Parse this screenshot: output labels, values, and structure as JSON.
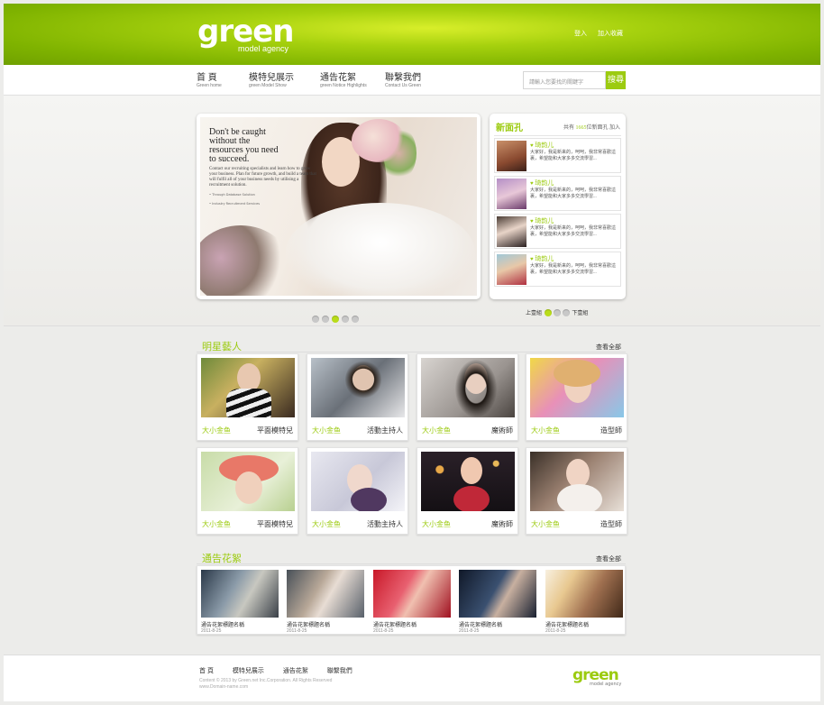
{
  "brand": {
    "logo_word": "green",
    "tagline": "model agency"
  },
  "top_links": [
    "登入",
    "加入收藏"
  ],
  "nav": [
    {
      "label": "首 頁",
      "sub": "Green home"
    },
    {
      "label": "模特兒展示",
      "sub": "green Model  Show"
    },
    {
      "label": "通告花絮",
      "sub": "green Notice Highlights"
    },
    {
      "label": "聯繫我們",
      "sub": "Contact Us Green"
    }
  ],
  "search": {
    "placeholder": "請輸入您要找的關鍵字",
    "button": "搜尋"
  },
  "slider": {
    "headline": [
      "Don't be caught",
      "without the",
      "resources you need",
      "to succeed."
    ],
    "body": "Contact our recruiting specialists and learn how to grow your business. Plan for future growth, and build a team that will fulfil all of your business needs by utilising a recruitment solution.",
    "footnotes": [
      "• Through Database Solution",
      "• Industry Recruitment Services"
    ],
    "dots": 5,
    "active_dot": 3
  },
  "new_faces": {
    "title": "新面孔",
    "count_prefix": "共有",
    "count": "1665",
    "count_suffix": "位新面孔  加入",
    "items": [
      {
        "name": "琦韵儿",
        "desc": "大家好，我是新来的，呵呵，我非常喜歡這裏，希望能和大家多多交流學習..."
      },
      {
        "name": "琦韵儿",
        "desc": "大家好，我是新来的，呵呵，我非常喜歡這裏，希望能和大家多多交流學習..."
      },
      {
        "name": "琦韵儿",
        "desc": "大家好，我是新来的，呵呵，我非常喜歡這裏，希望能和大家多多交流學習..."
      },
      {
        "name": "琦韵儿",
        "desc": "大家好，我是新来的，呵呵，我非常喜歡這裏，希望能和大家多多交流學習..."
      }
    ],
    "prev": "上壹組",
    "next": "下壹組",
    "pager_dots": 3,
    "active_pager": 1
  },
  "stars": {
    "title": "明星藝人",
    "view_all": "查看全部",
    "cards": [
      {
        "name": "大小金鱼",
        "role": "平面模特兒"
      },
      {
        "name": "大小金鱼",
        "role": "活動主持人"
      },
      {
        "name": "大小金鱼",
        "role": "魔術師"
      },
      {
        "name": "大小金鱼",
        "role": "造型師"
      },
      {
        "name": "大小金鱼",
        "role": "平面模特兒"
      },
      {
        "name": "大小金鱼",
        "role": "活動主持人"
      },
      {
        "name": "大小金鱼",
        "role": "魔術師"
      },
      {
        "name": "大小金鱼",
        "role": "造型師"
      }
    ]
  },
  "notices": {
    "title": "通告花絮",
    "view_all": "查看全部",
    "items": [
      {
        "title": "通告花絮標題名稱",
        "date": "2011-8-25"
      },
      {
        "title": "通告花絮標題名稱",
        "date": "2011-8-25"
      },
      {
        "title": "通告花絮標題名稱",
        "date": "2011-8-25"
      },
      {
        "title": "通告花絮標題名稱",
        "date": "2011-8-25"
      },
      {
        "title": "通告花絮標題名稱",
        "date": "2011-8-25"
      }
    ]
  },
  "footer": {
    "links": [
      "首 頁",
      "模特兒展示",
      "通告花絮",
      "聯繫我們"
    ],
    "copyright": "Content © 2013 by Green.net Inc.Corporation. All Rights Reserved",
    "domain": "www.Domain-name.com",
    "logo_word": "green",
    "tagline": "model agency"
  },
  "colors": {
    "accent": "#9ccb10",
    "header_dark": "#7fb300",
    "header_light": "#d8ee2a",
    "background": "#ececea"
  }
}
